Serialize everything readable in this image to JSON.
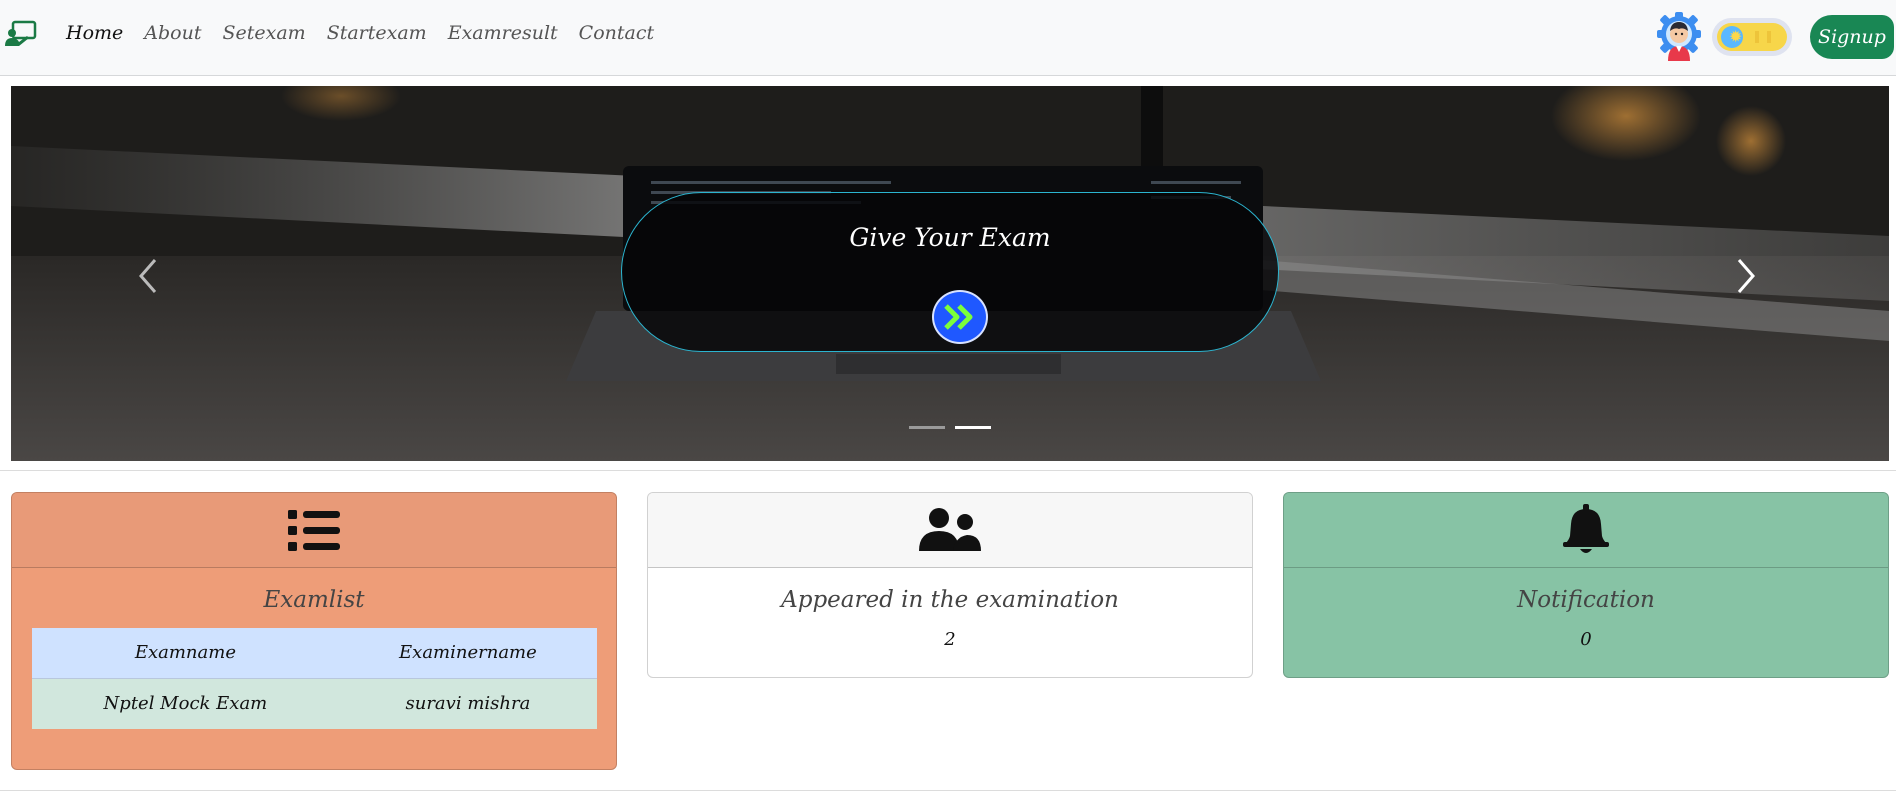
{
  "navbar": {
    "brand_icon": "classroom-icon",
    "links": [
      {
        "label": "Home",
        "active": true
      },
      {
        "label": "About",
        "active": false
      },
      {
        "label": "Setexam",
        "active": false
      },
      {
        "label": "Startexam",
        "active": false
      },
      {
        "label": "Examresult",
        "active": false
      },
      {
        "label": "Contact",
        "active": false
      }
    ],
    "avatar_icon": "user-gear-icon",
    "theme_toggle_icon": "sun-toggle-icon",
    "signup_label": "Signup"
  },
  "carousel": {
    "caption_title": "Give Your Exam",
    "go_button_icon": "double-chevron-right-icon",
    "prev_icon": "chevron-left-icon",
    "next_icon": "chevron-right-icon",
    "active_slide": 2,
    "slide_count": 2
  },
  "cards": {
    "examlist": {
      "icon": "list-icon",
      "title": "Examlist",
      "columns": [
        "Examname",
        "Examinername"
      ],
      "rows": [
        [
          "Nptel Mock Exam",
          "suravi mishra"
        ]
      ]
    },
    "appeared": {
      "icon": "users-icon",
      "title": "Appeared in the examination",
      "value": "2"
    },
    "notification": {
      "icon": "bell-icon",
      "title": "Notification",
      "value": "0"
    }
  },
  "colors": {
    "primary_green": "#198754",
    "examlist_card": "#ee9d78",
    "notification_card": "#87c3a5",
    "table_header": "#cfe2ff",
    "table_row": "#d1e7dd",
    "caption_border": "#2bb4cf",
    "go_button": "#1f58ff",
    "go_chevron": "#7cff3a"
  }
}
